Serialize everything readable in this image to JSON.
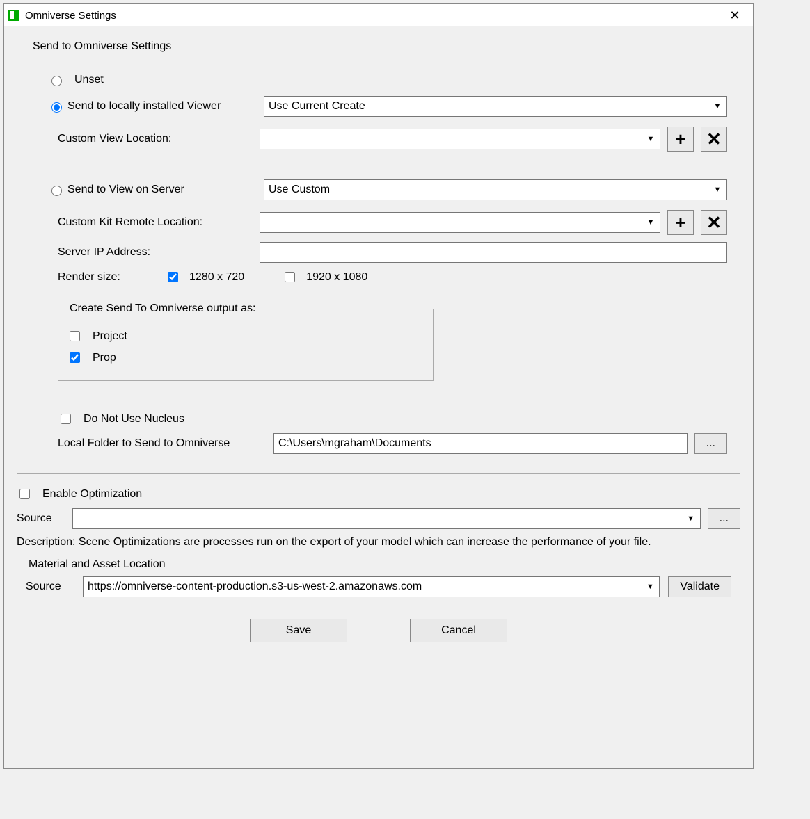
{
  "window": {
    "title": "Omniverse Settings"
  },
  "groups": {
    "send_settings": {
      "legend": "Send to Omniverse Settings",
      "unset_label": "Unset",
      "send_local_label": "Send to locally installed Viewer",
      "local_viewer_value": "Use Current Create",
      "custom_view_loc_label": "Custom View Location:",
      "custom_view_loc_value": "",
      "send_server_label": "Send to View on Server",
      "server_select_value": "Use Custom",
      "custom_kit_label": "Custom Kit Remote Location:",
      "custom_kit_value": "",
      "server_ip_label": "Server IP Address:",
      "server_ip_value": "",
      "render_size_label": "Render size:",
      "render_720": "1280 x 720",
      "render_1080": "1920 x 1080",
      "output_as": {
        "legend": "Create Send To Omniverse output as:",
        "project": "Project",
        "prop": "Prop"
      },
      "no_nucleus_label": "Do Not Use Nucleus",
      "local_folder_label": "Local Folder to Send to Omniverse",
      "local_folder_value": "C:\\Users\\mgraham\\Documents"
    },
    "optimization": {
      "enable_label": "Enable Optimization",
      "source_label": "Source",
      "source_value": "",
      "description": "Description: Scene Optimizations are processes run on the export of your model which can increase the performance of your file."
    },
    "material": {
      "legend": "Material and Asset Location",
      "source_label": "Source",
      "source_value": "https://omniverse-content-production.s3-us-west-2.amazonaws.com",
      "validate": "Validate"
    }
  },
  "buttons": {
    "save": "Save",
    "cancel": "Cancel",
    "browse": "...",
    "add": "+",
    "remove": "✕"
  }
}
